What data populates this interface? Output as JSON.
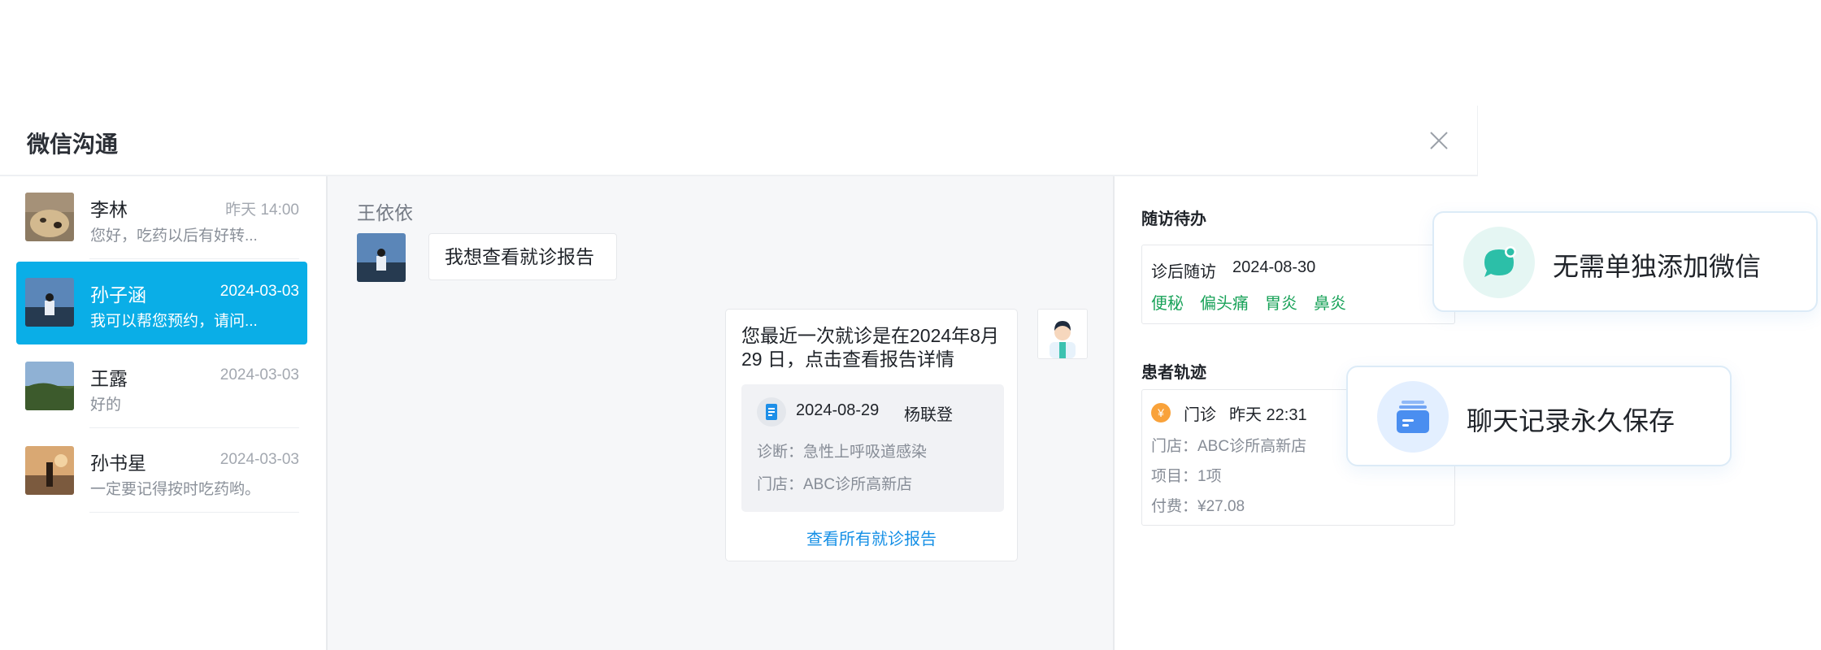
{
  "window": {
    "title": "微信沟通"
  },
  "contacts": [
    {
      "name": "李林",
      "time": "昨天 14:00",
      "preview": "您好，吃药以后有好转..."
    },
    {
      "name": "孙子涵",
      "time": "2024-03-03",
      "preview": "我可以帮您预约，请问...",
      "active": true
    },
    {
      "name": "王露",
      "time": "2024-03-03",
      "preview": "好的"
    },
    {
      "name": "孙书星",
      "time": "2024-03-03",
      "preview": "一定要记得按时吃药哟。"
    }
  ],
  "chat": {
    "user_name": "王依依",
    "incoming": "我想查看就诊报告",
    "outgoing_text": "您最近一次就诊是在2024年8月29 日，点击查看报告详情",
    "report": {
      "date": "2024-08-29",
      "doctor": "杨联登",
      "diagnosis": "诊断：急性上呼吸道感染",
      "store": "门店：ABC诊所高新店"
    },
    "view_all": "查看所有就诊报告"
  },
  "panel": {
    "todo_heading": "随访待办",
    "todo": {
      "title": "诊后随访",
      "date": "2024-08-30",
      "tags": [
        "便秘",
        "偏头痛",
        "胃炎",
        "鼻炎"
      ]
    },
    "track_heading": "患者轨迹",
    "track": {
      "coin": "¥",
      "type": "门诊",
      "time": "昨天 22:31",
      "store": "门店：ABC诊所高新店",
      "items": "项目：1项",
      "fee": "付费：¥27.08"
    }
  },
  "features": [
    {
      "text": "无需单独添加微信",
      "icon": "chat-bubble-icon"
    },
    {
      "text": "聊天记录永久保存",
      "icon": "archive-box-icon"
    }
  ],
  "colors": {
    "accent": "#0aaee7",
    "link": "#1690e6",
    "tag_green": "#1aa35a",
    "coin_orange": "#f9a23a",
    "feature_teal": "#2cbfa8",
    "feature_blue": "#4a8ef0"
  }
}
